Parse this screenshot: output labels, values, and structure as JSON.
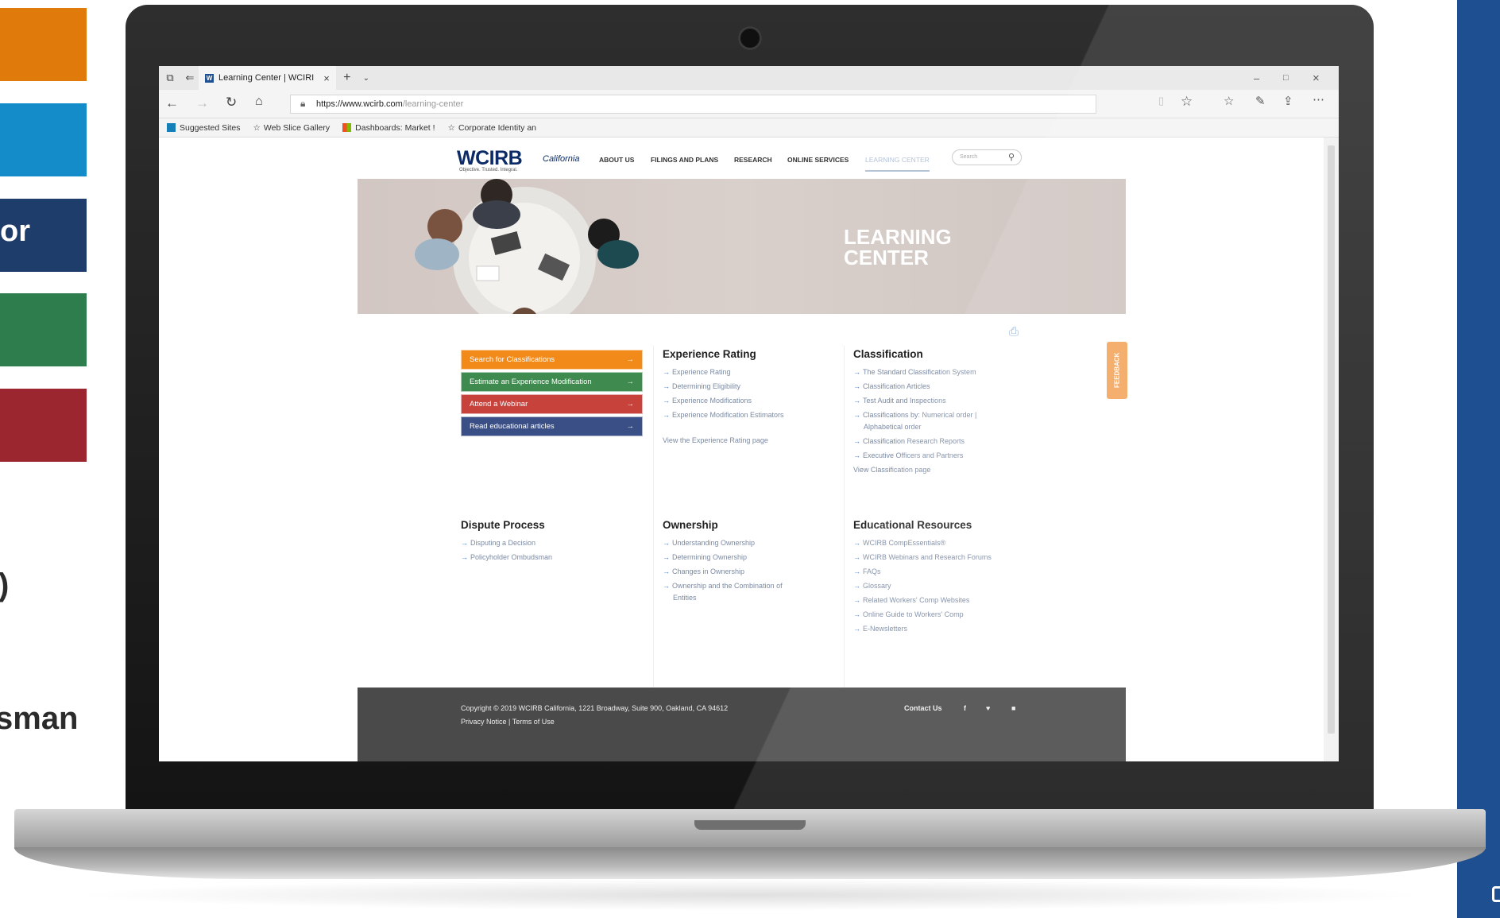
{
  "slide": {
    "left_labels": [
      "or",
      ")",
      "sman"
    ],
    "tile_colors": [
      "#e07b0b",
      "#138cc9",
      "#1f3d6b",
      "#2e7d4c",
      "#9c2630"
    ],
    "right_bar_color": "#1d4f91"
  },
  "browser": {
    "tab_title": "Learning Center | WCIRI",
    "url_domain": "https://www.wcirb.com",
    "url_path": "/learning-center",
    "favorites": [
      "Suggested Sites",
      "Web Slice Gallery",
      "Dashboards: Market !",
      "Corporate Identity an"
    ]
  },
  "site": {
    "logo_main": "WCIRB",
    "logo_sub": "California",
    "tagline": "Objective. Trusted. Integral.",
    "nav": [
      "ABOUT US",
      "FILINGS AND PLANS",
      "RESEARCH",
      "ONLINE SERVICES",
      "LEARNING CENTER"
    ],
    "search_placeholder": "Search",
    "hero_title_line1": "LEARNING",
    "hero_title_line2": "CENTER",
    "buttons": [
      {
        "label": "Search for Classifications",
        "color": "#f28a1a"
      },
      {
        "label": "Estimate an Experience Modification",
        "color": "#3f8b4f"
      },
      {
        "label": "Attend a Webinar",
        "color": "#c8423c"
      },
      {
        "label": "Read educational articles",
        "color": "#3a4f85"
      }
    ],
    "experience_rating": {
      "title": "Experience Rating",
      "links": [
        "Experience Rating",
        "Determining Eligibility",
        "Experience Modifications",
        "Experience Modification Estimators"
      ],
      "view": "View the Experience Rating page"
    },
    "classification": {
      "title": "Classification",
      "links": [
        "The Standard Classification System",
        "Classification Articles",
        "Test Audit and Inspections",
        "Classifications by: Numerical order |",
        "Classification Research Reports",
        "Executive Officers and Partners"
      ],
      "wrap": "Alphabetical order",
      "view": "View Classification page"
    },
    "dispute": {
      "title": "Dispute Process",
      "links": [
        "Disputing a Decision",
        "Policyholder Ombudsman"
      ]
    },
    "ownership": {
      "title": "Ownership",
      "links": [
        "Understanding Ownership",
        "Determining Ownership",
        "Changes in Ownership",
        "Ownership and the Combination of"
      ],
      "wrap": "Entities"
    },
    "educational": {
      "title": "Educational Resources",
      "links": [
        "WCIRB CompEssentials®",
        "WCIRB Webinars and Research Forums",
        "FAQs",
        "Glossary",
        "Related Workers' Comp Websites",
        "Online Guide to Workers' Comp",
        "E-Newsletters"
      ]
    },
    "feedback": "FEEDBACK",
    "footer": {
      "copyright": "Copyright © 2019 WCIRB California, 1221 Broadway, Suite 900, Oakland, CA 94612",
      "links": "Privacy Notice | Terms of Use",
      "contact": "Contact Us",
      "social": [
        "f",
        "♥",
        "■"
      ]
    }
  }
}
